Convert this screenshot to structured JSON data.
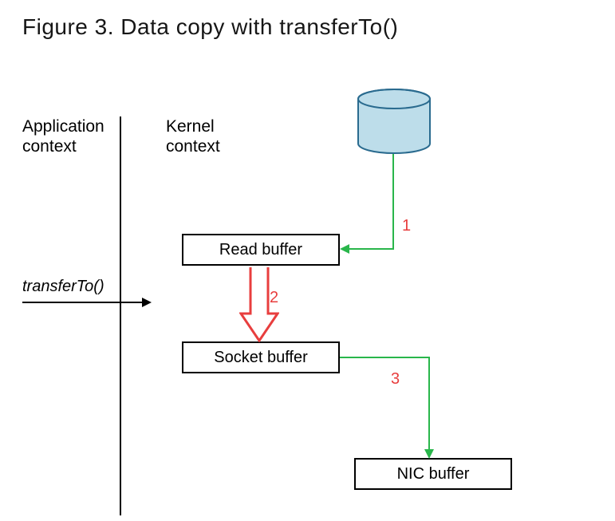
{
  "title": "Figure 3. Data copy with transferTo()",
  "labels": {
    "application_context": "Application\ncontext",
    "kernel_context": "Kernel\ncontext",
    "transfer_call": "transferTo()"
  },
  "boxes": {
    "read_buffer": "Read buffer",
    "socket_buffer": "Socket buffer",
    "nic_buffer": "NIC buffer"
  },
  "steps": {
    "one": "1",
    "two": "2",
    "three": "3"
  },
  "arrows": [
    {
      "id": 1,
      "from": "disk",
      "to": "read_buffer",
      "color": "green",
      "label": "1"
    },
    {
      "id": 2,
      "from": "read_buffer",
      "to": "socket_buffer",
      "color": "red",
      "label": "2"
    },
    {
      "id": 3,
      "from": "socket_buffer",
      "to": "nic_buffer",
      "color": "green",
      "label": "3"
    }
  ],
  "icons": {
    "disk": "cylinder-icon"
  }
}
